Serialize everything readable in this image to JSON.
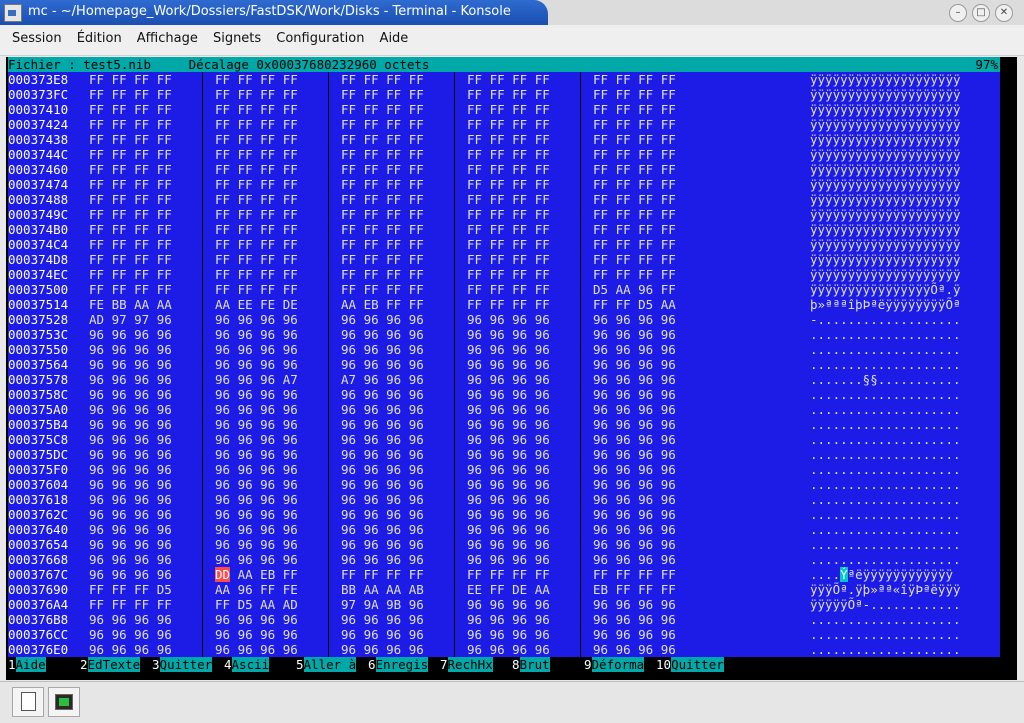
{
  "window": {
    "title": "mc - ~/Homepage_Work/Dossiers/FastDSK/Work/Disks - Terminal - Konsole",
    "buttons": {
      "minimize": "–",
      "maximize": "□",
      "close": "✕"
    }
  },
  "menu": [
    "Session",
    "Édition",
    "Affichage",
    "Signets",
    "Configuration",
    "Aide"
  ],
  "viewer": {
    "header_file": "Fichier : test5.nib",
    "header_offset": "Décalage 0x00037680232960 octets",
    "header_percent": "97%",
    "rows": [
      {
        "addr": "000373E8",
        "g": [
          "FF FF FF FF",
          "FF FF FF FF",
          "FF FF FF FF",
          "FF FF FF FF",
          "FF FF FF FF"
        ],
        "ascii": "ÿÿÿÿÿÿÿÿÿÿÿÿÿÿÿÿÿÿÿÿ"
      },
      {
        "addr": "000373FC",
        "g": [
          "FF FF FF FF",
          "FF FF FF FF",
          "FF FF FF FF",
          "FF FF FF FF",
          "FF FF FF FF"
        ],
        "ascii": "ÿÿÿÿÿÿÿÿÿÿÿÿÿÿÿÿÿÿÿÿ"
      },
      {
        "addr": "00037410",
        "g": [
          "FF FF FF FF",
          "FF FF FF FF",
          "FF FF FF FF",
          "FF FF FF FF",
          "FF FF FF FF"
        ],
        "ascii": "ÿÿÿÿÿÿÿÿÿÿÿÿÿÿÿÿÿÿÿÿ"
      },
      {
        "addr": "00037424",
        "g": [
          "FF FF FF FF",
          "FF FF FF FF",
          "FF FF FF FF",
          "FF FF FF FF",
          "FF FF FF FF"
        ],
        "ascii": "ÿÿÿÿÿÿÿÿÿÿÿÿÿÿÿÿÿÿÿÿ"
      },
      {
        "addr": "00037438",
        "g": [
          "FF FF FF FF",
          "FF FF FF FF",
          "FF FF FF FF",
          "FF FF FF FF",
          "FF FF FF FF"
        ],
        "ascii": "ÿÿÿÿÿÿÿÿÿÿÿÿÿÿÿÿÿÿÿÿ"
      },
      {
        "addr": "0003744C",
        "g": [
          "FF FF FF FF",
          "FF FF FF FF",
          "FF FF FF FF",
          "FF FF FF FF",
          "FF FF FF FF"
        ],
        "ascii": "ÿÿÿÿÿÿÿÿÿÿÿÿÿÿÿÿÿÿÿÿ"
      },
      {
        "addr": "00037460",
        "g": [
          "FF FF FF FF",
          "FF FF FF FF",
          "FF FF FF FF",
          "FF FF FF FF",
          "FF FF FF FF"
        ],
        "ascii": "ÿÿÿÿÿÿÿÿÿÿÿÿÿÿÿÿÿÿÿÿ"
      },
      {
        "addr": "00037474",
        "g": [
          "FF FF FF FF",
          "FF FF FF FF",
          "FF FF FF FF",
          "FF FF FF FF",
          "FF FF FF FF"
        ],
        "ascii": "ÿÿÿÿÿÿÿÿÿÿÿÿÿÿÿÿÿÿÿÿ"
      },
      {
        "addr": "00037488",
        "g": [
          "FF FF FF FF",
          "FF FF FF FF",
          "FF FF FF FF",
          "FF FF FF FF",
          "FF FF FF FF"
        ],
        "ascii": "ÿÿÿÿÿÿÿÿÿÿÿÿÿÿÿÿÿÿÿÿ"
      },
      {
        "addr": "0003749C",
        "g": [
          "FF FF FF FF",
          "FF FF FF FF",
          "FF FF FF FF",
          "FF FF FF FF",
          "FF FF FF FF"
        ],
        "ascii": "ÿÿÿÿÿÿÿÿÿÿÿÿÿÿÿÿÿÿÿÿ"
      },
      {
        "addr": "000374B0",
        "g": [
          "FF FF FF FF",
          "FF FF FF FF",
          "FF FF FF FF",
          "FF FF FF FF",
          "FF FF FF FF"
        ],
        "ascii": "ÿÿÿÿÿÿÿÿÿÿÿÿÿÿÿÿÿÿÿÿ"
      },
      {
        "addr": "000374C4",
        "g": [
          "FF FF FF FF",
          "FF FF FF FF",
          "FF FF FF FF",
          "FF FF FF FF",
          "FF FF FF FF"
        ],
        "ascii": "ÿÿÿÿÿÿÿÿÿÿÿÿÿÿÿÿÿÿÿÿ"
      },
      {
        "addr": "000374D8",
        "g": [
          "FF FF FF FF",
          "FF FF FF FF",
          "FF FF FF FF",
          "FF FF FF FF",
          "FF FF FF FF"
        ],
        "ascii": "ÿÿÿÿÿÿÿÿÿÿÿÿÿÿÿÿÿÿÿÿ"
      },
      {
        "addr": "000374EC",
        "g": [
          "FF FF FF FF",
          "FF FF FF FF",
          "FF FF FF FF",
          "FF FF FF FF",
          "FF FF FF FF"
        ],
        "ascii": "ÿÿÿÿÿÿÿÿÿÿÿÿÿÿÿÿÿÿÿÿ"
      },
      {
        "addr": "00037500",
        "g": [
          "FF FF FF FF",
          "FF FF FF FF",
          "FF FF FF FF",
          "FF FF FF FF",
          "D5 AA 96 FF"
        ],
        "ascii": "ÿÿÿÿÿÿÿÿÿÿÿÿÿÿÿÿÕª.ÿ"
      },
      {
        "addr": "00037514",
        "g": [
          "FE BB AA AA",
          "AA EE FE DE",
          "AA EB FF FF",
          "FF FF FF FF",
          "FF FF D5 AA"
        ],
        "ascii": "þ»ªªªîþÞªëÿÿÿÿÿÿÿÿÕª"
      },
      {
        "addr": "00037528",
        "g": [
          "AD 97 97 96",
          "96 96 96 96",
          "96 96 96 96",
          "96 96 96 96",
          "96 96 96 96"
        ],
        "ascii": "-..................."
      },
      {
        "addr": "0003753C",
        "g": [
          "96 96 96 96",
          "96 96 96 96",
          "96 96 96 96",
          "96 96 96 96",
          "96 96 96 96"
        ],
        "ascii": "...................."
      },
      {
        "addr": "00037550",
        "g": [
          "96 96 96 96",
          "96 96 96 96",
          "96 96 96 96",
          "96 96 96 96",
          "96 96 96 96"
        ],
        "ascii": "...................."
      },
      {
        "addr": "00037564",
        "g": [
          "96 96 96 96",
          "96 96 96 96",
          "96 96 96 96",
          "96 96 96 96",
          "96 96 96 96"
        ],
        "ascii": "...................."
      },
      {
        "addr": "00037578",
        "g": [
          "96 96 96 96",
          "96 96 96 A7",
          "A7 96 96 96",
          "96 96 96 96",
          "96 96 96 96"
        ],
        "ascii": ".......§§..........."
      },
      {
        "addr": "0003758C",
        "g": [
          "96 96 96 96",
          "96 96 96 96",
          "96 96 96 96",
          "96 96 96 96",
          "96 96 96 96"
        ],
        "ascii": "...................."
      },
      {
        "addr": "000375A0",
        "g": [
          "96 96 96 96",
          "96 96 96 96",
          "96 96 96 96",
          "96 96 96 96",
          "96 96 96 96"
        ],
        "ascii": "...................."
      },
      {
        "addr": "000375B4",
        "g": [
          "96 96 96 96",
          "96 96 96 96",
          "96 96 96 96",
          "96 96 96 96",
          "96 96 96 96"
        ],
        "ascii": "...................."
      },
      {
        "addr": "000375C8",
        "g": [
          "96 96 96 96",
          "96 96 96 96",
          "96 96 96 96",
          "96 96 96 96",
          "96 96 96 96"
        ],
        "ascii": "...................."
      },
      {
        "addr": "000375DC",
        "g": [
          "96 96 96 96",
          "96 96 96 96",
          "96 96 96 96",
          "96 96 96 96",
          "96 96 96 96"
        ],
        "ascii": "...................."
      },
      {
        "addr": "000375F0",
        "g": [
          "96 96 96 96",
          "96 96 96 96",
          "96 96 96 96",
          "96 96 96 96",
          "96 96 96 96"
        ],
        "ascii": "...................."
      },
      {
        "addr": "00037604",
        "g": [
          "96 96 96 96",
          "96 96 96 96",
          "96 96 96 96",
          "96 96 96 96",
          "96 96 96 96"
        ],
        "ascii": "...................."
      },
      {
        "addr": "00037618",
        "g": [
          "96 96 96 96",
          "96 96 96 96",
          "96 96 96 96",
          "96 96 96 96",
          "96 96 96 96"
        ],
        "ascii": "...................."
      },
      {
        "addr": "0003762C",
        "g": [
          "96 96 96 96",
          "96 96 96 96",
          "96 96 96 96",
          "96 96 96 96",
          "96 96 96 96"
        ],
        "ascii": "...................."
      },
      {
        "addr": "00037640",
        "g": [
          "96 96 96 96",
          "96 96 96 96",
          "96 96 96 96",
          "96 96 96 96",
          "96 96 96 96"
        ],
        "ascii": "...................."
      },
      {
        "addr": "00037654",
        "g": [
          "96 96 96 96",
          "96 96 96 96",
          "96 96 96 96",
          "96 96 96 96",
          "96 96 96 96"
        ],
        "ascii": "...................."
      },
      {
        "addr": "00037668",
        "g": [
          "96 96 96 96",
          "96 96 96 96",
          "96 96 96 96",
          "96 96 96 96",
          "96 96 96 96"
        ],
        "ascii": "...................."
      },
      {
        "addr": "0003767C",
        "g": [
          "96 96 96 96",
          "DD AA EB FF",
          "FF FF FF FF",
          "FF FF FF FF",
          "FF FF FF FF"
        ],
        "ascii": "....Ýªëÿÿÿÿÿÿÿÿÿÿÿÿ",
        "cursor": true
      },
      {
        "addr": "00037690",
        "g": [
          "FF FF FF D5",
          "AA 96 FF FE",
          "BB AA AA AB",
          "EE FF DE AA",
          "EB FF FF FF"
        ],
        "ascii": "ÿÿÿÕª.ÿþ»ªª«îÿÞªëÿÿÿ"
      },
      {
        "addr": "000376A4",
        "g": [
          "FF FF FF FF",
          "FF D5 AA AD",
          "97 9A 9B 96",
          "96 96 96 96",
          "96 96 96 96"
        ],
        "ascii": "ÿÿÿÿÿÕª-............"
      },
      {
        "addr": "000376B8",
        "g": [
          "96 96 96 96",
          "96 96 96 96",
          "96 96 96 96",
          "96 96 96 96",
          "96 96 96 96"
        ],
        "ascii": "...................."
      },
      {
        "addr": "000376CC",
        "g": [
          "96 96 96 96",
          "96 96 96 96",
          "96 96 96 96",
          "96 96 96 96",
          "96 96 96 96"
        ],
        "ascii": "...................."
      },
      {
        "addr": "000376E0",
        "g": [
          "96 96 96 96",
          "96 96 96 96",
          "96 96 96 96",
          "96 96 96 96",
          "96 96 96 96"
        ],
        "ascii": "...................."
      }
    ]
  },
  "fkeys": [
    {
      "num": "1",
      "label": "Aide  "
    },
    {
      "num": " 2",
      "label": "EdTexte"
    },
    {
      "num": "3",
      "label": "Quitter"
    },
    {
      "num": "4",
      "label": "Ascii "
    },
    {
      "num": " 5",
      "label": "Aller à"
    },
    {
      "num": "6",
      "label": "Enregis"
    },
    {
      "num": "7",
      "label": "RechHx"
    },
    {
      "num": " 8",
      "label": "Brut  "
    },
    {
      "num": " 9",
      "label": "Déforma"
    },
    {
      "num": "10",
      "label": "Quitter"
    }
  ],
  "colors": {
    "panel_bg": "#1c1ce6",
    "header_bg": "#00a8a8",
    "cursor_hex": "#ff4a4a",
    "cursor_ascii": "#00c8c8"
  }
}
